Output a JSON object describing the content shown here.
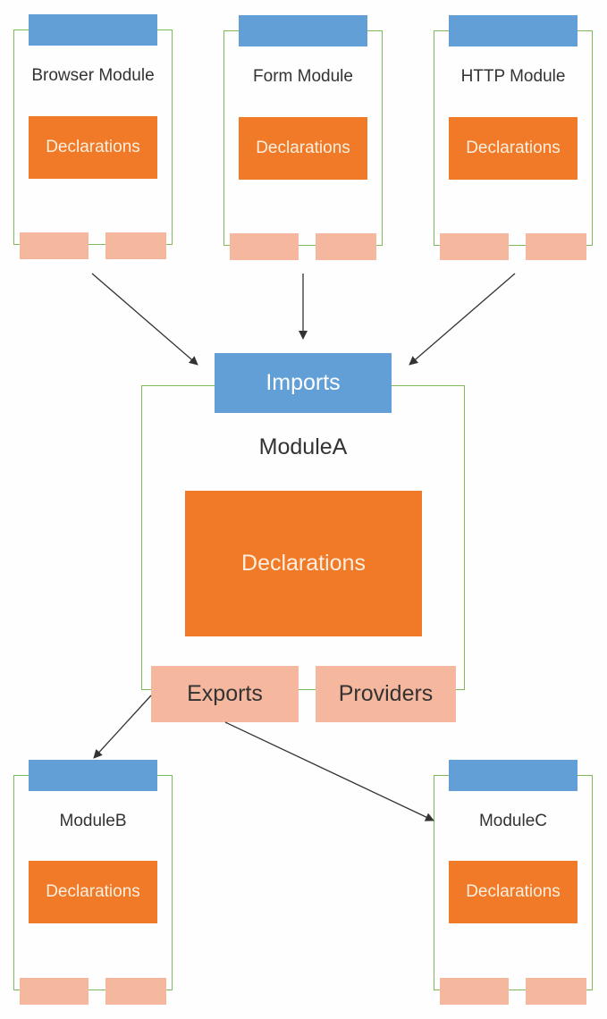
{
  "colors": {
    "frame": "#7dba5a",
    "header": "#629fd7",
    "declarations": "#f07a28",
    "footer": "#f5b79e",
    "arrow": "#333333"
  },
  "top_modules": [
    {
      "name": "Browser Module",
      "declarations": "Declarations"
    },
    {
      "name": "Form Module",
      "declarations": "Declarations"
    },
    {
      "name": "HTTP Module",
      "declarations": "Declarations"
    }
  ],
  "module_a": {
    "name": "ModuleA",
    "imports": "Imports",
    "declarations": "Declarations",
    "exports": "Exports",
    "providers": "Providers"
  },
  "bottom_modules": [
    {
      "name": "ModuleB",
      "declarations": "Declarations"
    },
    {
      "name": "ModuleC",
      "declarations": "Declarations"
    }
  ],
  "edges": [
    {
      "from": "Browser Module",
      "to": "ModuleA.Imports"
    },
    {
      "from": "Form Module",
      "to": "ModuleA.Imports"
    },
    {
      "from": "HTTP Module",
      "to": "ModuleA.Imports"
    },
    {
      "from": "ModuleA.Exports",
      "to": "ModuleB"
    },
    {
      "from": "ModuleA.Exports",
      "to": "ModuleC"
    }
  ]
}
